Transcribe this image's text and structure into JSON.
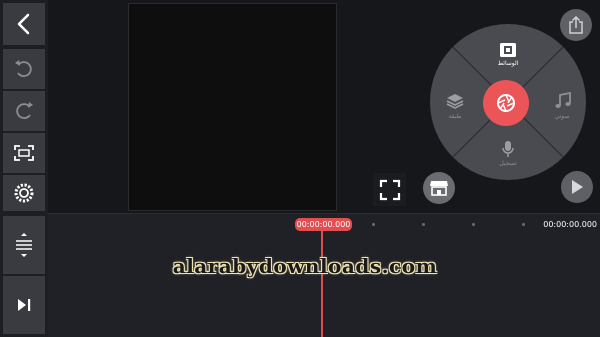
{
  "timeline": {
    "current_time": "00:00:00.000",
    "total_time": "00:00:00.000"
  },
  "wheel": {
    "media_label": "الوسائط",
    "layer_label": "طبقة",
    "audio_label": "صوتي",
    "record_label": "تسجيل"
  },
  "watermark": {
    "text": "alarabydownloads.com"
  },
  "colors": {
    "accent": "#ec5557",
    "playhead": "#e14b4e",
    "background": "#16171b",
    "panel": "#3a3b40",
    "wheel": "#4a4b50"
  },
  "icons": [
    "back-icon",
    "undo-icon",
    "redo-icon",
    "crop-icon",
    "settings-icon",
    "track-height-icon",
    "jump-to-end-icon",
    "fullscreen-icon",
    "store-icon",
    "share-icon",
    "play-icon",
    "media-icon",
    "layer-icon",
    "audio-icon",
    "mic-icon",
    "camera-shutter-icon"
  ]
}
